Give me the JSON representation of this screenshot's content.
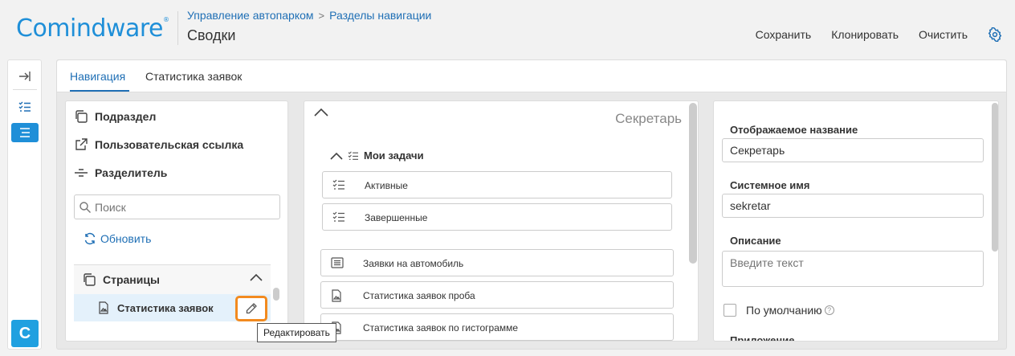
{
  "header": {
    "logo": "Comindware",
    "logo_mark": "®",
    "breadcrumb": [
      "Управление автопарком",
      "Разделы навигации"
    ],
    "breadcrumb_sep": ">",
    "title": "Сводки",
    "actions": [
      "Сохранить",
      "Клонировать",
      "Очистить"
    ]
  },
  "rail": {
    "badge": "C"
  },
  "tabs": [
    "Навигация",
    "Статистика заявок"
  ],
  "toolbox": {
    "items": [
      "Подраздел",
      "Пользовательская ссылка",
      "Разделитель"
    ],
    "search_placeholder": "Поиск",
    "refresh": "Обновить",
    "tree": {
      "group": "Страницы",
      "selected": "Статистика заявок",
      "edit_tooltip": "Редактировать"
    }
  },
  "preview": {
    "title": "Секретарь",
    "group": "Мои задачи",
    "group_items": [
      "Активные",
      "Завершенные"
    ],
    "items": [
      "Заявки на автомобиль",
      "Статистика заявок проба",
      "Статистика заявок по гистограмме"
    ]
  },
  "properties": {
    "display_name_label": "Отображаемое название",
    "display_name_value": "Секретарь",
    "system_name_label": "Системное имя",
    "system_name_value": "sekretar",
    "description_label": "Описание",
    "description_placeholder": "Введите текст",
    "default_label": "По умолчанию",
    "help_glyph": "?",
    "app_label": "Приложение"
  },
  "colors": {
    "accent": "#1f8fd8",
    "link": "#1f6fb5",
    "highlight": "#f28a1f"
  }
}
